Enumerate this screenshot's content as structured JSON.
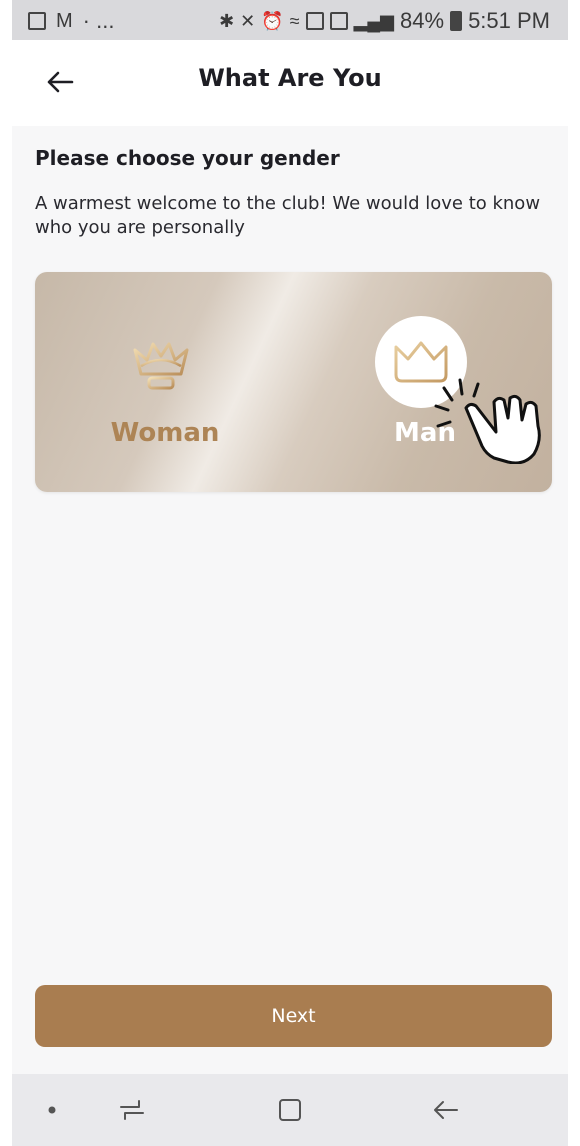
{
  "status_bar": {
    "dots": "· ...",
    "battery_text": "84%",
    "time": "5:51 PM"
  },
  "header": {
    "title": "What Are You",
    "back_icon": "arrow-left-icon"
  },
  "content": {
    "heading": "Please choose your gender",
    "description": "A warmest welcome to the club! We would love to know who you are personally"
  },
  "gender_options": [
    {
      "label": "Woman",
      "icon": "queen-crown-icon",
      "selected": false
    },
    {
      "label": "Man",
      "icon": "king-crown-icon",
      "selected": true
    }
  ],
  "next_button": {
    "label": "Next"
  },
  "nav_bar": {
    "icons": [
      "dot-icon",
      "recent-apps-icon",
      "home-icon",
      "back-icon"
    ]
  },
  "colors": {
    "accent": "#a97d50",
    "woman_label": "#ad8455",
    "card_base": "#c9baa9"
  }
}
